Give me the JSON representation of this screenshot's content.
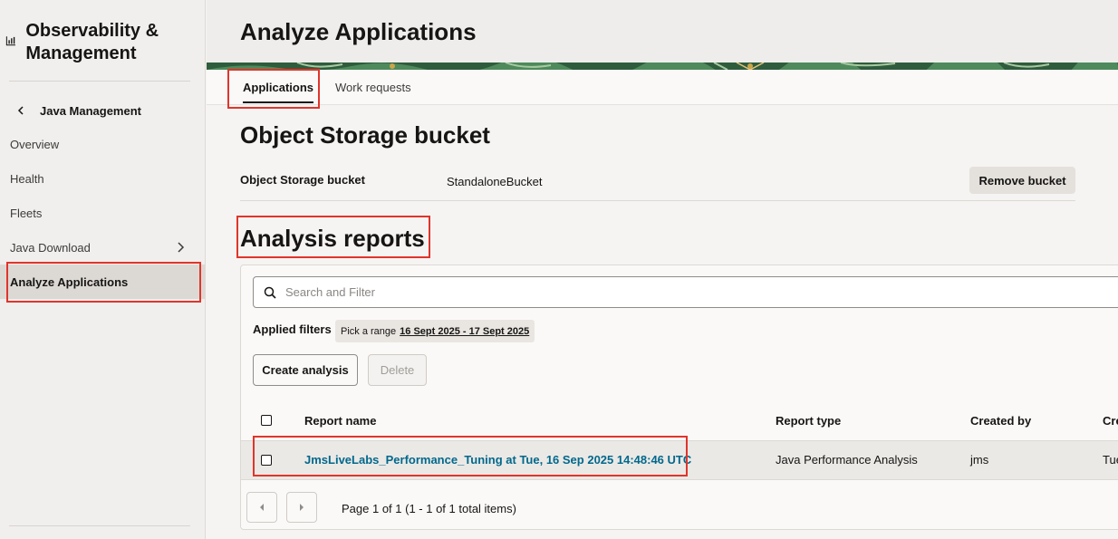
{
  "sidebar": {
    "brand_title": "Observability & Management",
    "back_label": "Java Management",
    "items": [
      {
        "label": "Overview"
      },
      {
        "label": "Health"
      },
      {
        "label": "Fleets"
      },
      {
        "label": "Java Download"
      },
      {
        "label": "Analyze Applications"
      }
    ]
  },
  "page": {
    "title": "Analyze Applications",
    "tabs": [
      {
        "label": "Applications",
        "active": true
      },
      {
        "label": "Work requests",
        "active": false
      }
    ]
  },
  "bucket": {
    "heading": "Object Storage bucket",
    "label": "Object Storage bucket",
    "value": "StandaloneBucket",
    "remove_label": "Remove bucket"
  },
  "reports": {
    "heading": "Analysis reports",
    "search_placeholder": "Search and Filter",
    "applied_filters_label": "Applied filters",
    "filter_chip_prefix": "Pick a range",
    "filter_chip_value": "16 Sept 2025 - 17 Sept 2025",
    "create_label": "Create analysis",
    "delete_label": "Delete",
    "columns": [
      "Report name",
      "Report type",
      "Created by",
      "Cre"
    ],
    "rows": [
      {
        "name": "JmsLiveLabs_Performance_Tuning at Tue, 16 Sep 2025 14:48:46 UTC",
        "type": "Java Performance Analysis",
        "created_by": "jms",
        "created": "Tue"
      }
    ],
    "pagination": "Page 1 of 1 (1 - 1 of 1 total items)"
  },
  "colors": {
    "highlight": "#e0352b",
    "link": "#00688c",
    "active_nav_bg": "#dcd9d5"
  }
}
